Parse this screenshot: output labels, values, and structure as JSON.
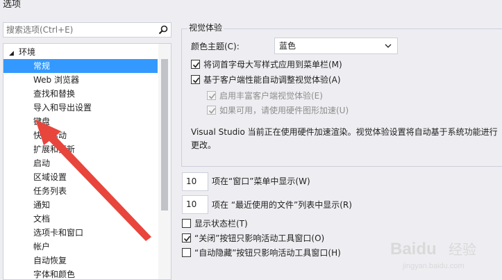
{
  "window": {
    "title": "选项"
  },
  "search": {
    "placeholder": "搜索选项(Ctrl+E)"
  },
  "tree": {
    "root_label": "环境",
    "items": [
      {
        "label": "常规",
        "selected": true
      },
      {
        "label": "Web 浏览器"
      },
      {
        "label": "查找和替换"
      },
      {
        "label": "导入和导出设置"
      },
      {
        "label": "键盘"
      },
      {
        "label": "快速启动"
      },
      {
        "label": "扩展和更新"
      },
      {
        "label": "启动"
      },
      {
        "label": "区域设置"
      },
      {
        "label": "任务列表"
      },
      {
        "label": "通知"
      },
      {
        "label": "文档"
      },
      {
        "label": "选项卡和窗口"
      },
      {
        "label": "帐户"
      },
      {
        "label": "自动恢复"
      },
      {
        "label": "字体和颜色"
      }
    ]
  },
  "visual": {
    "group_title": "视觉体验",
    "theme_label": "颜色主题(C):",
    "theme_value": "蓝色",
    "cb_uppercase": "将词首字母大写样式应用到菜单栏(M)",
    "cb_auto_adjust": "基于客户端性能自动调整视觉体验(A)",
    "cb_rich": "启用丰富客户端视觉体验(E)",
    "cb_hardware": "如果可用，请使用硬件图形加速(U)",
    "description": "Visual Studio 当前正在使用硬件加速渲染。视觉体验设置将自动基于系统功能进行更改。"
  },
  "window_menu": {
    "count": "10",
    "label": "项在“窗口”菜单中显示(W)"
  },
  "recent_files": {
    "count": "10",
    "label": "项在 “最近使用的文件”列表中显示(R)"
  },
  "status_bar": {
    "label": "显示状态栏(T)"
  },
  "close_button": {
    "label": "“关闭”按钮只影响活动工具窗口(O)"
  },
  "autohide_button": {
    "label": "“自动隐藏”按钮只影响活动工具窗口(H)"
  },
  "watermark": {
    "brand": "Baidu",
    "suffix": "经验",
    "url": "jingyan.baidu.com"
  },
  "colors": {
    "selection": "#3399ff",
    "arrow": "#e8453c"
  }
}
